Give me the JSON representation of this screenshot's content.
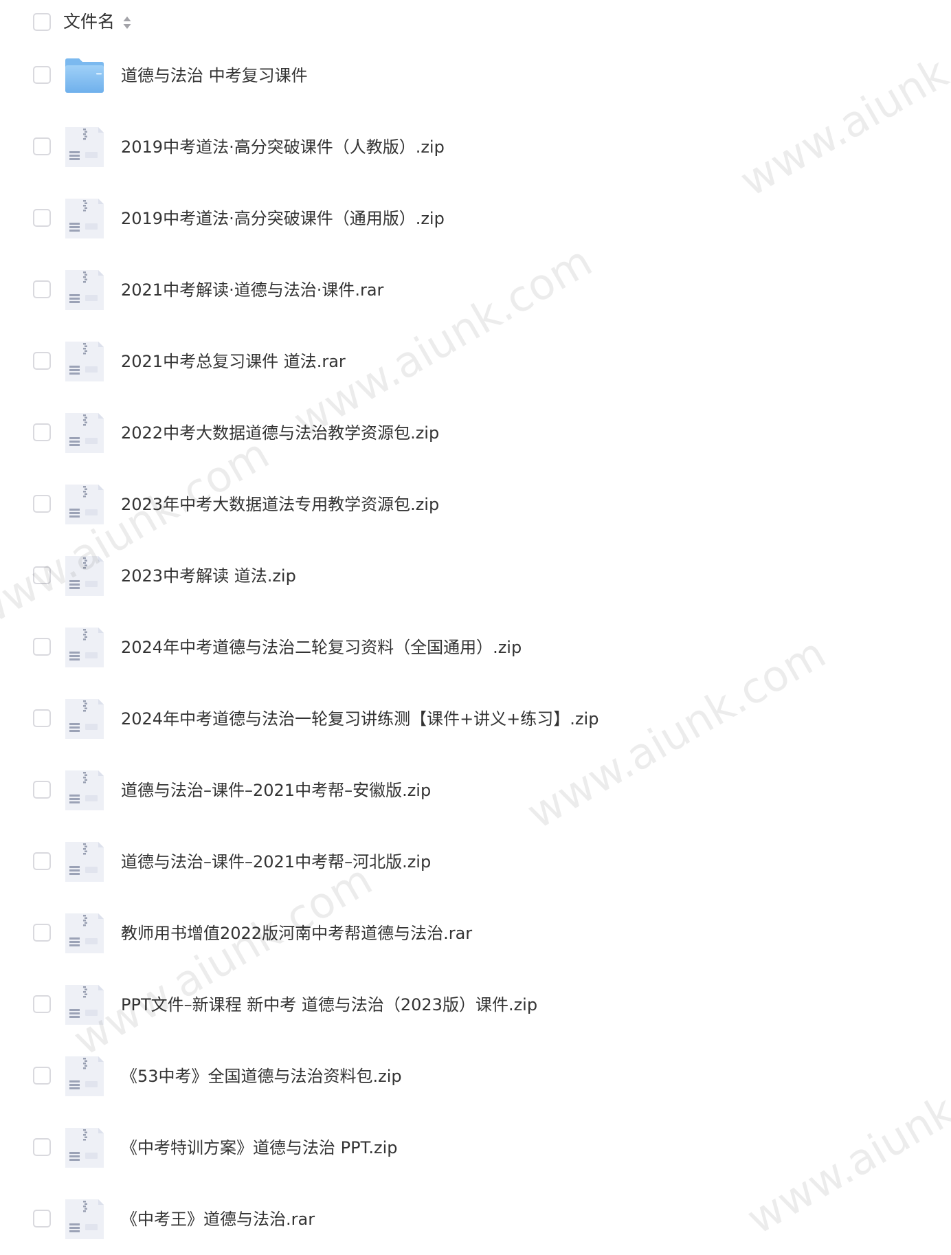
{
  "header": {
    "title": "文件名"
  },
  "files": [
    {
      "name": "道德与法治 中考复习课件",
      "type": "folder"
    },
    {
      "name": "2019中考道法·高分突破课件（人教版）.zip",
      "type": "archive"
    },
    {
      "name": "2019中考道法·高分突破课件（通用版）.zip",
      "type": "archive"
    },
    {
      "name": "2021中考解读·道德与法治·课件.rar",
      "type": "archive"
    },
    {
      "name": "2021中考总复习课件 道法.rar",
      "type": "archive"
    },
    {
      "name": "2022中考大数据道德与法治教学资源包.zip",
      "type": "archive"
    },
    {
      "name": "2023年中考大数据道法专用教学资源包.zip",
      "type": "archive"
    },
    {
      "name": "2023中考解读 道法.zip",
      "type": "archive"
    },
    {
      "name": "2024年中考道德与法治二轮复习资料（全国通用）.zip",
      "type": "archive"
    },
    {
      "name": "2024年中考道德与法治一轮复习讲练测【课件+讲义+练习】.zip",
      "type": "archive"
    },
    {
      "name": "道德与法治–课件–2021中考帮–安徽版.zip",
      "type": "archive"
    },
    {
      "name": "道德与法治–课件–2021中考帮–河北版.zip",
      "type": "archive"
    },
    {
      "name": "教师用书增值2022版河南中考帮道德与法治.rar",
      "type": "archive"
    },
    {
      "name": "PPT文件–新课程 新中考 道德与法治（2023版）课件.zip",
      "type": "archive"
    },
    {
      "name": "《53中考》全国道德与法治资料包.zip",
      "type": "archive"
    },
    {
      "name": "《中考特训方案》道德与法治 PPT.zip",
      "type": "archive"
    },
    {
      "name": "《中考王》道德与法治.rar",
      "type": "archive"
    }
  ],
  "watermark": {
    "text": "www.aiunk.com"
  },
  "colors": {
    "text": "#333333",
    "checkbox_border": "#d9d9de",
    "folder": "#8ec5f3",
    "archive_icon": "#eef0f6"
  },
  "icons": {
    "folder": "folder-icon",
    "archive": "zip-file-icon",
    "sort": "sort-icon"
  }
}
